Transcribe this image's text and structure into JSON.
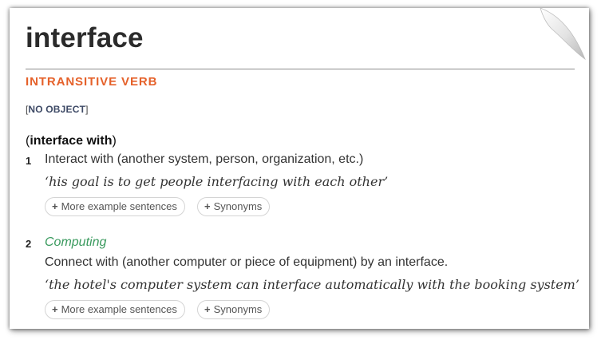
{
  "entry": {
    "headword": "interface",
    "part_of_speech": "INTRANSITIVE VERB",
    "grammar": {
      "open": "[",
      "label": "NO OBJECT",
      "close": "]"
    },
    "phrase": {
      "open": "(",
      "text": "interface with",
      "close": ")"
    }
  },
  "senses": [
    {
      "number": "1",
      "domain": "",
      "definition": "Interact with (another system, person, organization, etc.)",
      "example": "‘his goal is to get people interfacing with each other’",
      "more_examples_label": "More example sentences",
      "synonyms_label": "Synonyms"
    },
    {
      "number": "2",
      "domain": "Computing",
      "definition": "Connect with (another computer or piece of equipment) by an interface.",
      "example": "‘the hotel's computer system can interface automatically with the booking system’",
      "more_examples_label": "More example sentences",
      "synonyms_label": "Synonyms"
    }
  ],
  "icons": {
    "expand": "plus-icon",
    "page_curl": "page-curl-icon"
  },
  "colors": {
    "part_of_speech": "#e5612a",
    "domain_label": "#3a9a5e",
    "grammar_label": "#3e4a66"
  }
}
